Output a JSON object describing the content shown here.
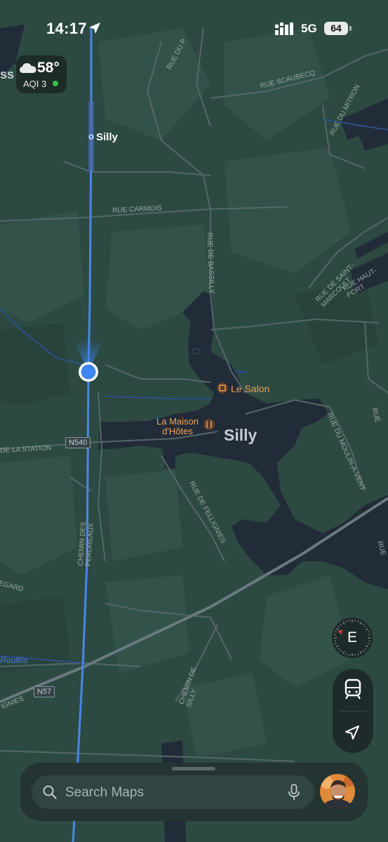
{
  "status_bar": {
    "time": "14:17",
    "network": "5G",
    "battery": "64",
    "icons": [
      "location-arrow-icon",
      "signal-bars-icon"
    ]
  },
  "weather": {
    "temperature": "58°",
    "aqi": "AQI 3",
    "aqi_status_color": "#35c24a",
    "icon": "cloud-icon"
  },
  "map": {
    "places": {
      "silly_stop": "Silly",
      "silly_town": "Silly",
      "le_salon": "Le Salon",
      "maison_line1": "La Maison",
      "maison_line2": "d'Hôtes",
      "partial_top_left": "ss"
    },
    "roads": {
      "carmois": "RUE CARMOIS",
      "bassilly": "RUE DE BASSILLY",
      "scaubecq": "RUE SCAUBECQ",
      "mitron": "RUE DU MITRON",
      "rue_du_top": "RUE DU P",
      "saint_marcoult": "RUE DE SAINT-MARCOULT",
      "haut_port": "RUE HAUT-PORT",
      "station": "DE LA STATION",
      "perdreaux": "CHEMIN DES PERDREAUX",
      "fellignies": "RUE DE FELLIGNIES",
      "moulin_a_vent": "RUE DU MOULIN-A-VENT",
      "chemin_silly": "CHEMIN DE SILLY",
      "egard": "EGARD",
      "right_edge_1": "RUE",
      "right_edge_2": "RUE",
      "ignies": "IGNIES",
      "roulkis": "Roulkis"
    },
    "shields": {
      "n540": "N540",
      "n57": "N57"
    },
    "colors": {
      "land": "#2c4a42",
      "land_light": "#34534a",
      "urban": "#222b38",
      "road": "#55676a",
      "route": "#4a86e8",
      "poi": "#f0a35a"
    }
  },
  "controls": {
    "compass_heading": "E",
    "transit_icon": "tram-icon",
    "locate_icon": "location-arrow-icon"
  },
  "search": {
    "placeholder": "Search Maps"
  }
}
